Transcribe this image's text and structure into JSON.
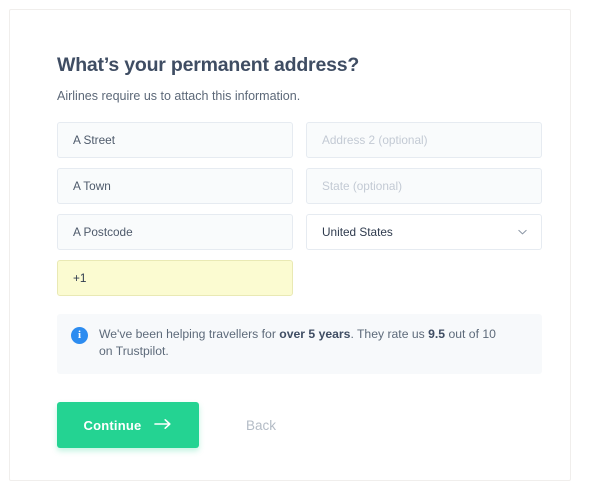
{
  "form": {
    "heading": "What’s your permanent address?",
    "subheading": "Airlines require us to attach this information.",
    "fields": [
      {
        "name": "street",
        "value": "A Street",
        "state": "filled"
      },
      {
        "name": "address2",
        "value": "Address 2 (optional)",
        "state": "placeholder"
      },
      {
        "name": "town",
        "value": "A Town",
        "state": "filled"
      },
      {
        "name": "state",
        "value": "State (optional)",
        "state": "placeholder"
      },
      {
        "name": "postcode",
        "value": "A Postcode",
        "state": "filled"
      },
      {
        "name": "country",
        "value": "United States",
        "state": "select"
      },
      {
        "name": "phone",
        "value": "+1",
        "state": "autofill"
      }
    ]
  },
  "banner": {
    "icon": "info-icon",
    "text_1": "We've been helping travellers for ",
    "bold_1": "over 5 years",
    "text_2": ". They rate us ",
    "bold_2": "9.5",
    "text_3": " out of 10 on Trustpilot."
  },
  "actions": {
    "continue_label": "Continue",
    "continue_icon": "arrow-right-icon",
    "back_label": "Back"
  },
  "colors": {
    "accent_green": "#24d392",
    "info_blue": "#2d8cf0",
    "autofill_yellow": "#fbfbd1",
    "heading": "#3f4d63"
  }
}
